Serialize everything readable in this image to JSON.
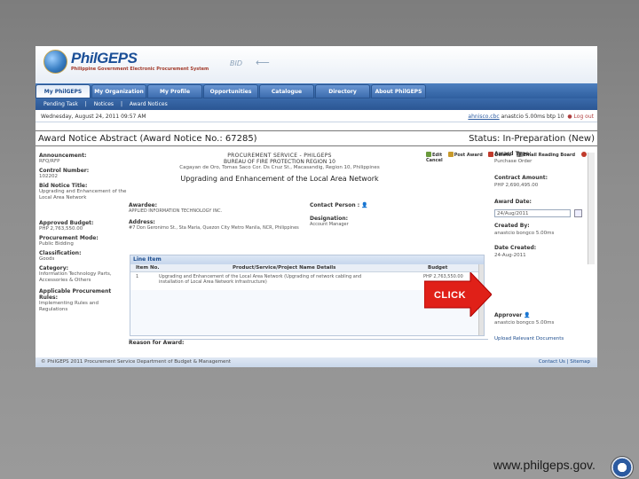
{
  "header": {
    "logo_name": "PhilGEPS",
    "logo_sub": "Philippine Government Electronic Procurement System",
    "bid_label": "BID"
  },
  "nav": {
    "tabs": [
      {
        "label": "My PhilGEPS",
        "active": true
      },
      {
        "label": "My Organization",
        "active": false
      },
      {
        "label": "My Profile",
        "active": false
      },
      {
        "label": "Opportunities",
        "active": false
      },
      {
        "label": "Catalogue",
        "active": false
      },
      {
        "label": "Directory",
        "active": false
      },
      {
        "label": "About PhilGEPS",
        "active": false
      }
    ],
    "subnav": [
      "Pending Task",
      "|",
      "Notices",
      "|",
      "Award Notices"
    ]
  },
  "infobar": {
    "left": "Wednesday, August 24, 2011 09:57 AM",
    "user": "ahnisco.cbc",
    "info": "anastcio 5.00ms  btp 10",
    "logout": "Log out"
  },
  "title": {
    "abstract": "Award Notice Abstract (Award Notice No.: 67285)",
    "status": "Status: In-Preparation (New)"
  },
  "toolbar": [
    "Edit",
    "Post Award",
    "Delete",
    "Email Reading Board",
    "Cancel"
  ],
  "left_fields": [
    {
      "label": "Announcement:",
      "value": "RFQ/RFP"
    },
    {
      "label": "Control Number:",
      "value": "102202"
    },
    {
      "label": "Bid Notice Title:",
      "value": "Upgrading and Enhancement of the Local Area Network"
    },
    {
      "label": "Approved Budget:",
      "value": "PHP 2,763,550.00"
    },
    {
      "label": "Procurement Mode:",
      "value": "Public Bidding"
    },
    {
      "label": "Classification:",
      "value": "Goods"
    },
    {
      "label": "Category:",
      "value": "Information Technology Parts, Accessories & Others"
    },
    {
      "label": "Applicable Procurement Rules:",
      "value": "Implementing Rules and Regulations"
    }
  ],
  "center": {
    "line1": "PROCUREMENT SERVICE - PHILGEPS",
    "line2": "BUREAU OF FIRE PROTECTION REGION 10",
    "line3": "Cagayan de Oro, Tomas Saco Cor. Ds Cruz St., Macasandig, Region 10, Philippines",
    "line4": "Upgrading and Enhancement of the Local Area Network"
  },
  "awardee": {
    "label": "Awardee:",
    "value": "APPLIED INFORMATION TECHNOLOGY INC.",
    "address_label": "Address:",
    "address_value": "#7 Don Geronimo St., Sta Maria, Quezon City Metro Manila, NCR, Philippines"
  },
  "contact": {
    "label": "Contact Person :",
    "designation_label": "Designation:",
    "designation_value": "Account Manager"
  },
  "line_item": {
    "title": "Line Item",
    "headers": [
      "Item No.",
      "Product/Service/Project Name Details",
      "Budget"
    ],
    "rows": [
      {
        "no": "1",
        "desc": "Upgrading and Enhancement of the Local Area Network (Upgrading of network cabling and installation of Local Area Network infrastructure)",
        "budget": "PHP 2,763,550.00"
      }
    ]
  },
  "reason_label": "Reason for Award:",
  "right_fields": {
    "award_type_label": "Award Type:",
    "award_type_value": "Purchase Order",
    "contract_amount_label": "Contract Amount:",
    "contract_amount_value": "PHP 2,690,495.00",
    "award_date_label": "Award Date:",
    "award_date_value": "24/Aug/2011",
    "created_by_label": "Created By:",
    "created_by_value": "anastcio bongco 5.00ms",
    "date_created_label": "Date Created:",
    "date_created_value": "24-Aug-2011",
    "approver_label": "Approver",
    "approver_value": "anastcio bongco 5.00ms",
    "upload_label": "Upload Relevant Documents"
  },
  "footer": {
    "left": "© PhilGEPS 2011 Procurement Service Department of Budget & Management",
    "right": "Contact Us | Sitemap"
  },
  "annotation": {
    "click": "CLICK"
  },
  "watermark": "www.philgeps.gov."
}
